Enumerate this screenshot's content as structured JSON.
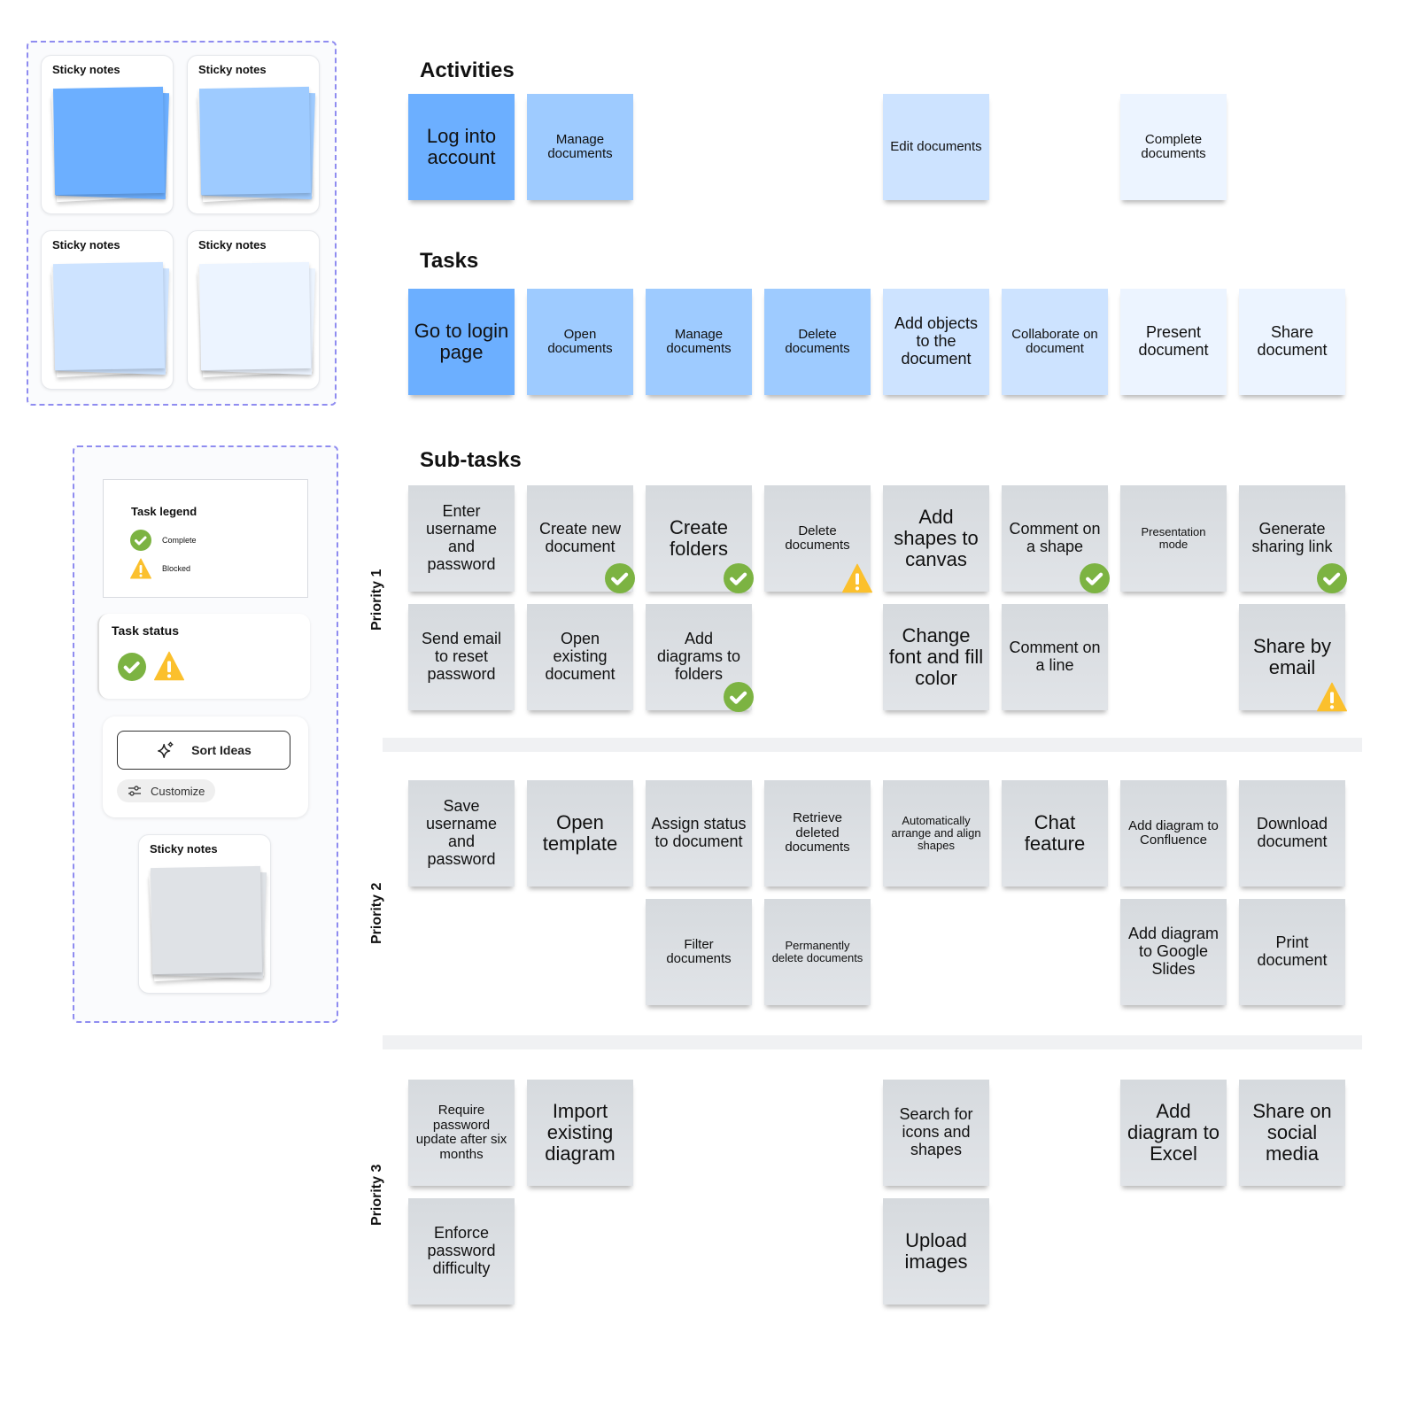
{
  "palette": {
    "cards": [
      {
        "title": "Sticky notes",
        "color": "#6cafff"
      },
      {
        "title": "Sticky notes",
        "color": "#9ecbff"
      },
      {
        "title": "Sticky notes",
        "color": "#cde3ff"
      },
      {
        "title": "Sticky notes",
        "color": "#ecf4ff"
      }
    ]
  },
  "tools": {
    "legend": {
      "title": "Task legend",
      "items": [
        {
          "icon": "check-circle-icon",
          "label": "Complete"
        },
        {
          "icon": "warning-triangle-icon",
          "label": "Blocked"
        }
      ]
    },
    "status": {
      "title": "Task status"
    },
    "sort_ideas": {
      "label": "Sort Ideas",
      "icon": "sparkle-icon"
    },
    "customize": {
      "label": "Customize",
      "icon": "sliders-icon"
    },
    "gray_sticky": {
      "title": "Sticky notes",
      "color": "#dfe2e6"
    }
  },
  "colors": {
    "complete": "#7cb342",
    "blocked": "#fbc02d",
    "frame_border": "#8f8cf0"
  },
  "sections": {
    "activities": "Activities",
    "tasks": "Tasks",
    "subtasks": "Sub-tasks"
  },
  "activities": [
    {
      "text": "Log into account",
      "col": 0,
      "color": "c1",
      "size": 22
    },
    {
      "text": "Manage documents",
      "col": 1,
      "color": "c2",
      "size": 15
    },
    {
      "text": "Edit documents",
      "col": 4,
      "color": "c3",
      "size": 15
    },
    {
      "text": "Complete documents",
      "col": 6,
      "color": "c4",
      "size": 15
    }
  ],
  "tasks": [
    {
      "text": "Go to login page",
      "col": 0,
      "color": "c1",
      "size": 22
    },
    {
      "text": "Open documents",
      "col": 1,
      "color": "c2",
      "size": 15
    },
    {
      "text": "Manage documents",
      "col": 2,
      "color": "c2",
      "size": 15
    },
    {
      "text": "Delete documents",
      "col": 3,
      "color": "c2",
      "size": 15
    },
    {
      "text": "Add objects to the document",
      "col": 4,
      "color": "c3",
      "size": 18
    },
    {
      "text": "Collaborate on document",
      "col": 5,
      "color": "c3",
      "size": 15
    },
    {
      "text": "Present document",
      "col": 6,
      "color": "c4",
      "size": 18
    },
    {
      "text": "Share document",
      "col": 7,
      "color": "c4",
      "size": 18
    }
  ],
  "priorities": [
    {
      "label": "Priority 1",
      "notes": [
        {
          "text": "Enter username and password",
          "col": 0,
          "row": 0,
          "size": 18,
          "status": ""
        },
        {
          "text": "Create new document",
          "col": 1,
          "row": 0,
          "size": 18,
          "status": "complete"
        },
        {
          "text": "Create folders",
          "col": 2,
          "row": 0,
          "size": 22,
          "status": "complete"
        },
        {
          "text": "Delete documents",
          "col": 3,
          "row": 0,
          "size": 15,
          "status": "blocked"
        },
        {
          "text": "Add shapes to canvas",
          "col": 4,
          "row": 0,
          "size": 22,
          "status": ""
        },
        {
          "text": "Comment on a shape",
          "col": 5,
          "row": 0,
          "size": 18,
          "status": "complete"
        },
        {
          "text": "Presentation mode",
          "col": 6,
          "row": 0,
          "size": 13,
          "status": ""
        },
        {
          "text": "Generate sharing link",
          "col": 7,
          "row": 0,
          "size": 18,
          "status": "complete"
        },
        {
          "text": "Send email to reset password",
          "col": 0,
          "row": 1,
          "size": 18,
          "status": ""
        },
        {
          "text": "Open existing document",
          "col": 1,
          "row": 1,
          "size": 18,
          "status": ""
        },
        {
          "text": "Add diagrams to folders",
          "col": 2,
          "row": 1,
          "size": 18,
          "status": "complete"
        },
        {
          "text": "Change font and fill color",
          "col": 4,
          "row": 1,
          "size": 22,
          "status": ""
        },
        {
          "text": "Comment on a line",
          "col": 5,
          "row": 1,
          "size": 18,
          "status": ""
        },
        {
          "text": "Share by email",
          "col": 7,
          "row": 1,
          "size": 22,
          "status": "blocked"
        }
      ]
    },
    {
      "label": "Priority 2",
      "notes": [
        {
          "text": "Save username and password",
          "col": 0,
          "row": 0,
          "size": 18,
          "status": ""
        },
        {
          "text": "Open template",
          "col": 1,
          "row": 0,
          "size": 22,
          "status": ""
        },
        {
          "text": "Assign status to document",
          "col": 2,
          "row": 0,
          "size": 18,
          "status": ""
        },
        {
          "text": "Retrieve deleted documents",
          "col": 3,
          "row": 0,
          "size": 15,
          "status": ""
        },
        {
          "text": "Automatically arrange and align shapes",
          "col": 4,
          "row": 0,
          "size": 13,
          "status": ""
        },
        {
          "text": "Chat feature",
          "col": 5,
          "row": 0,
          "size": 22,
          "status": ""
        },
        {
          "text": "Add diagram to Confluence",
          "col": 6,
          "row": 0,
          "size": 15,
          "status": ""
        },
        {
          "text": "Download document",
          "col": 7,
          "row": 0,
          "size": 18,
          "status": ""
        },
        {
          "text": "Filter documents",
          "col": 2,
          "row": 1,
          "size": 15,
          "status": ""
        },
        {
          "text": "Permanently delete documents",
          "col": 3,
          "row": 1,
          "size": 13,
          "status": ""
        },
        {
          "text": "Add diagram to Google Slides",
          "col": 6,
          "row": 1,
          "size": 18,
          "status": ""
        },
        {
          "text": "Print document",
          "col": 7,
          "row": 1,
          "size": 18,
          "status": ""
        }
      ]
    },
    {
      "label": "Priority 3",
      "notes": [
        {
          "text": "Require password update after six months",
          "col": 0,
          "row": 0,
          "size": 15,
          "status": ""
        },
        {
          "text": "Import existing diagram",
          "col": 1,
          "row": 0,
          "size": 22,
          "status": ""
        },
        {
          "text": "Search for icons and shapes",
          "col": 4,
          "row": 0,
          "size": 18,
          "status": ""
        },
        {
          "text": "Add diagram to Excel",
          "col": 6,
          "row": 0,
          "size": 22,
          "status": ""
        },
        {
          "text": "Share on social media",
          "col": 7,
          "row": 0,
          "size": 22,
          "status": ""
        },
        {
          "text": "Enforce password difficulty",
          "col": 0,
          "row": 1,
          "size": 18,
          "status": ""
        },
        {
          "text": "Upload images",
          "col": 4,
          "row": 1,
          "size": 22,
          "status": ""
        }
      ]
    }
  ]
}
